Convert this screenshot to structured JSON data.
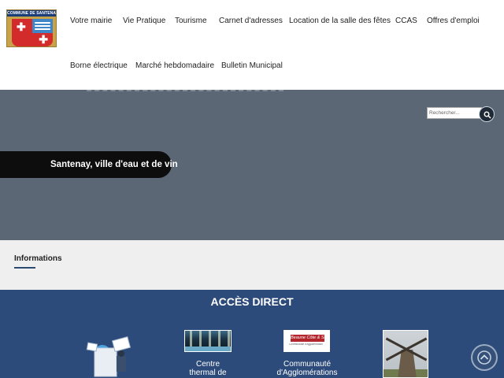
{
  "logo": {
    "text": "COMMUNE DE SANTENAY"
  },
  "nav": {
    "items": [
      "Votre mairie",
      "Vie Pratique",
      "Tourisme",
      "Carnet d'adresses",
      "Location de la salle des fêtes",
      "CCAS",
      "Offres d'emploi",
      "Borne électrique",
      "Marché hebdomadaire",
      "Bulletin Municipal"
    ]
  },
  "search": {
    "placeholder": "Rechercher..."
  },
  "hero": {
    "tagline": "Santenay, ville d'eau et de vin"
  },
  "informations": {
    "title": "Informations"
  },
  "acces": {
    "title": "ACCÈS DIRECT",
    "tiles": [
      {
        "label_lines": [
          "Centre",
          "thermal de"
        ]
      },
      {
        "label_lines": [
          "Communauté",
          "d'Agglomérations"
        ],
        "logo_text": "Beaune Côte & Sud",
        "logo_sub": "Communauté d'Agglomération"
      }
    ]
  },
  "colors": {
    "hero_bg": "#5b6774",
    "acces_bg": "#2d4b7a",
    "info_bg": "#efefef",
    "pill_bg": "#0d0d0d"
  }
}
